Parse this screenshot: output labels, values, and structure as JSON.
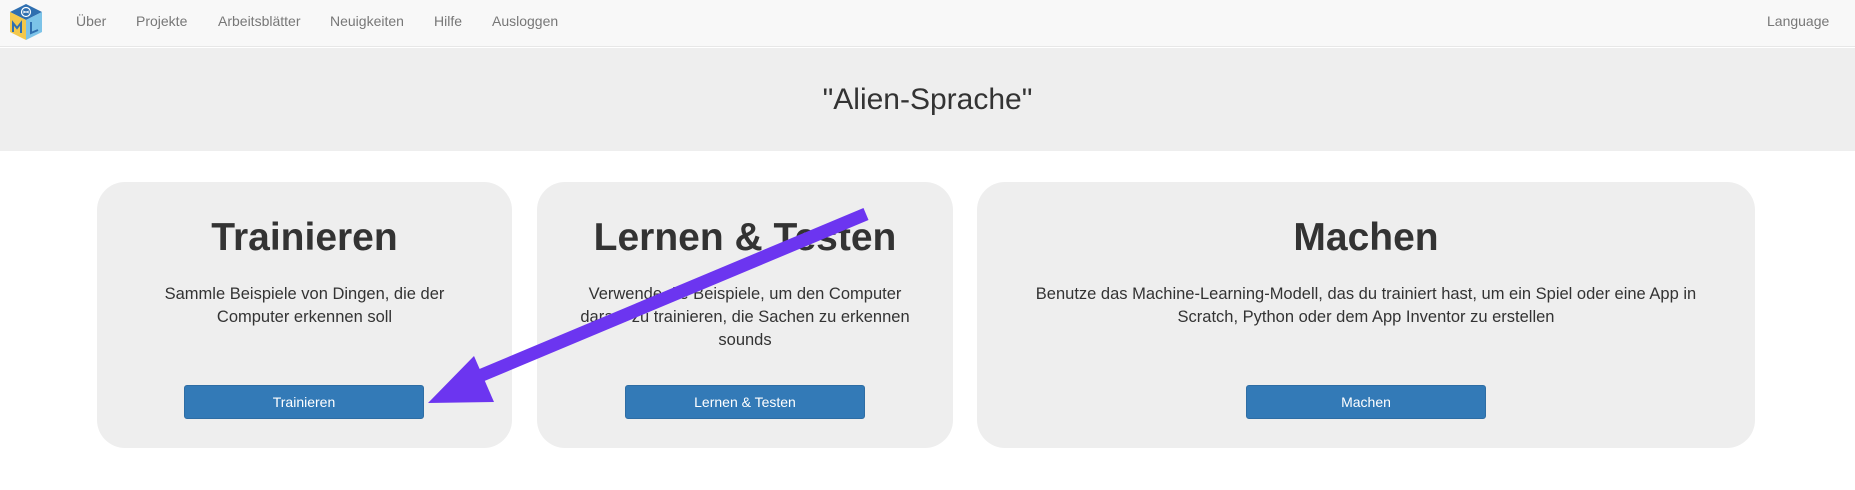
{
  "navbar": {
    "items": [
      "Über",
      "Projekte",
      "Arbeitsblätter",
      "Neuigkeiten",
      "Hilfe",
      "Ausloggen"
    ],
    "language": "Language"
  },
  "banner": {
    "title": "\"Alien-Sprache\""
  },
  "cards": [
    {
      "title": "Trainieren",
      "lines": [
        "Sammle Beispiele von Dingen, die der",
        "Computer erkennen soll"
      ],
      "button": "Trainieren"
    },
    {
      "title": "Lernen & Testen",
      "lines": [
        "Verwende die Beispiele, um den Computer",
        "darauf zu trainieren, die Sachen zu erkennen",
        "sounds"
      ],
      "button": "Lernen & Testen"
    },
    {
      "title": "Machen",
      "lines": [
        "Benutze das Machine-Learning-Modell, das du trainiert hast, um ein Spiel oder eine App in",
        "Scratch, Python oder dem App Inventor zu erstellen"
      ],
      "button": "Machen"
    }
  ],
  "colors": {
    "accent": "#337ab7",
    "annotation_arrow": "#6c35f0"
  }
}
